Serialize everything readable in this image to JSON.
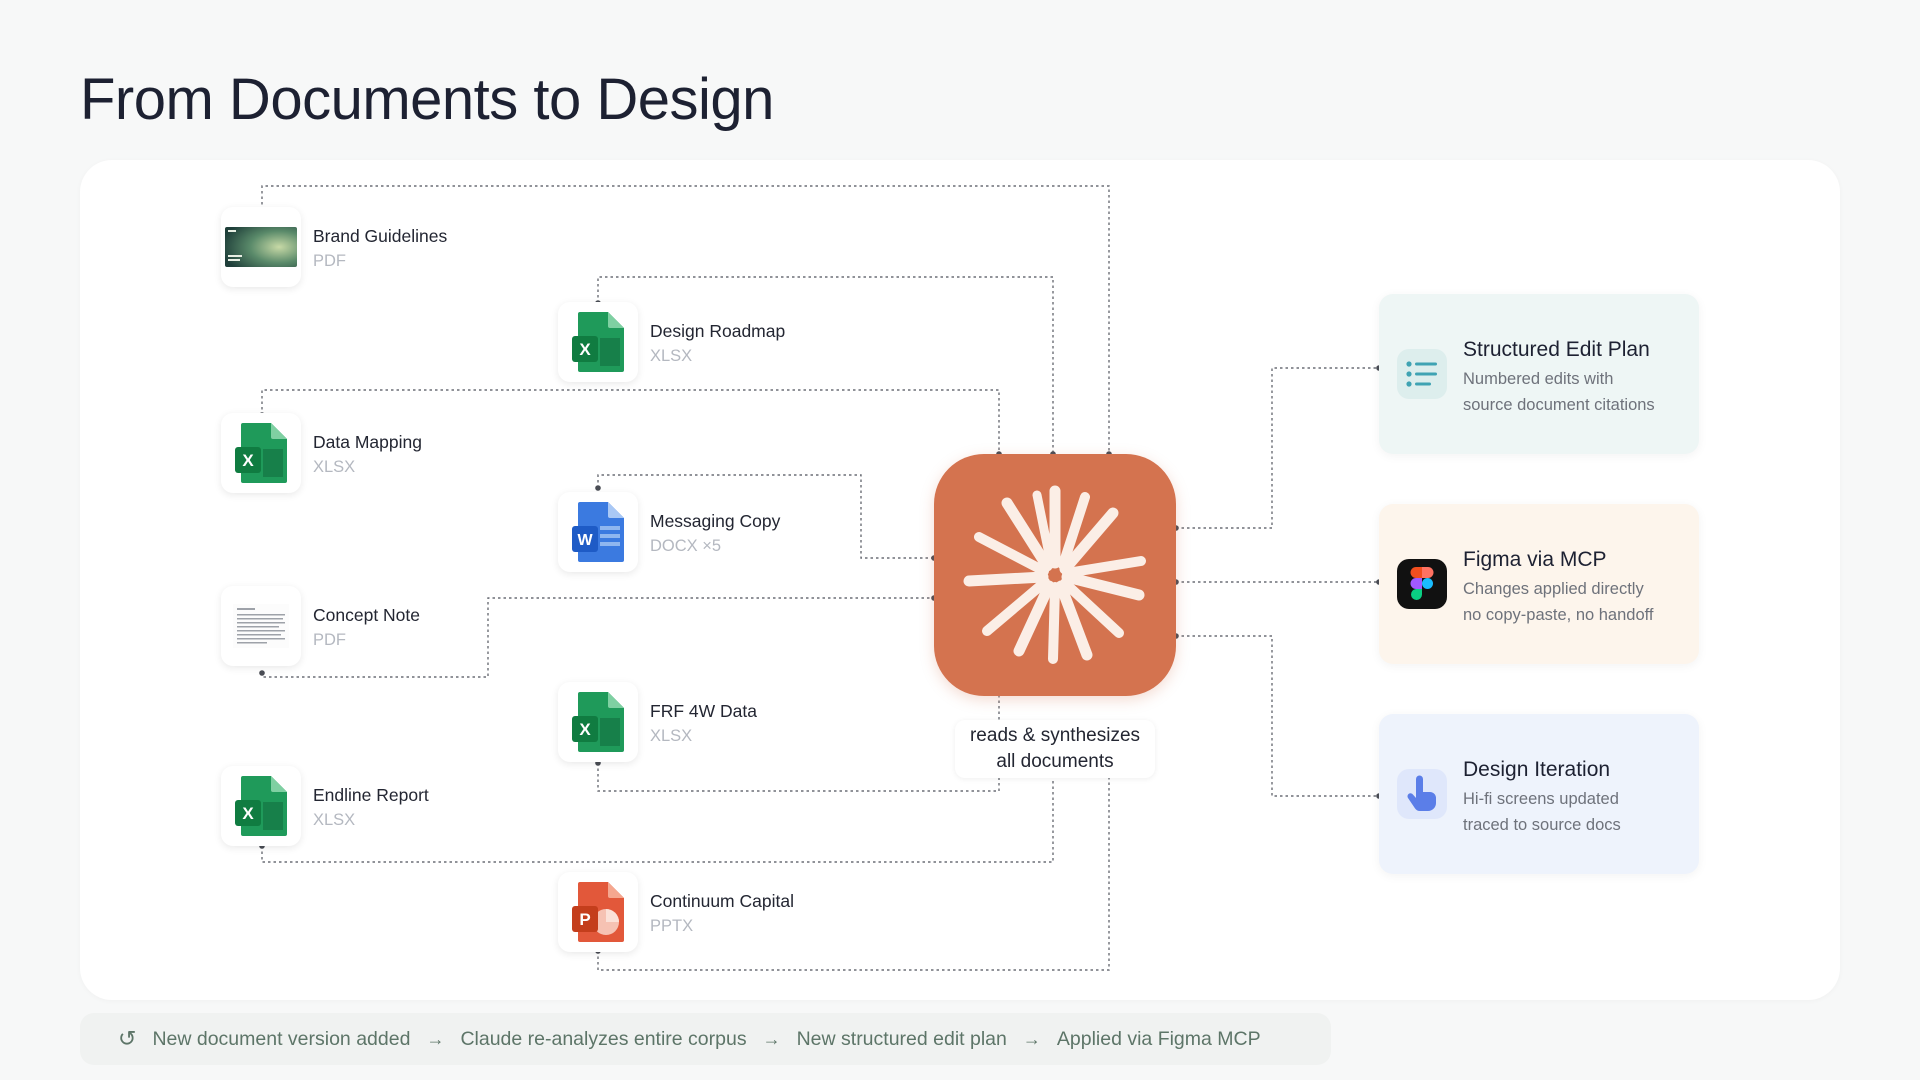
{
  "page_title": "From Documents to Design",
  "documents": [
    {
      "name": "Brand Guidelines",
      "type": "PDF",
      "icon": "pdf-cover-icon"
    },
    {
      "name": "Design Roadmap",
      "type": "XLSX",
      "icon": "excel-icon"
    },
    {
      "name": "Data Mapping",
      "type": "XLSX",
      "icon": "excel-icon"
    },
    {
      "name": "Messaging Copy",
      "type": "DOCX ×5",
      "icon": "word-icon"
    },
    {
      "name": "Concept Note",
      "type": "PDF",
      "icon": "pdf-doc-icon"
    },
    {
      "name": "FRF 4W Data",
      "type": "XLSX",
      "icon": "excel-icon"
    },
    {
      "name": "Endline Report",
      "type": "XLSX",
      "icon": "excel-icon"
    },
    {
      "name": "Continuum Capital",
      "type": "PPTX",
      "icon": "powerpoint-icon"
    }
  ],
  "hub": {
    "icon": "claude-starburst-icon",
    "caption_line1": "reads & synthesizes",
    "caption_line2": "all documents",
    "color": "#d4734f"
  },
  "outputs": [
    {
      "title": "Structured Edit Plan",
      "desc_line1": "Numbered edits with",
      "desc_line2": "source document citations",
      "icon": "list-icon",
      "bg": "#eef6f5"
    },
    {
      "title": "Figma via MCP",
      "desc_line1": "Changes applied directly",
      "desc_line2": "no copy-paste, no handoff",
      "icon": "figma-icon",
      "bg": "#fdf5ec"
    },
    {
      "title": "Design Iteration",
      "desc_line1": "Hi-fi screens updated",
      "desc_line2": "traced to source docs",
      "icon": "pointer-hand-icon",
      "bg": "#eef3fc"
    }
  ],
  "footer": {
    "icon": "refresh-icon",
    "steps": [
      "New document version added",
      "Claude re-analyzes entire corpus",
      "New structured edit plan",
      "Applied via Figma MCP"
    ]
  }
}
